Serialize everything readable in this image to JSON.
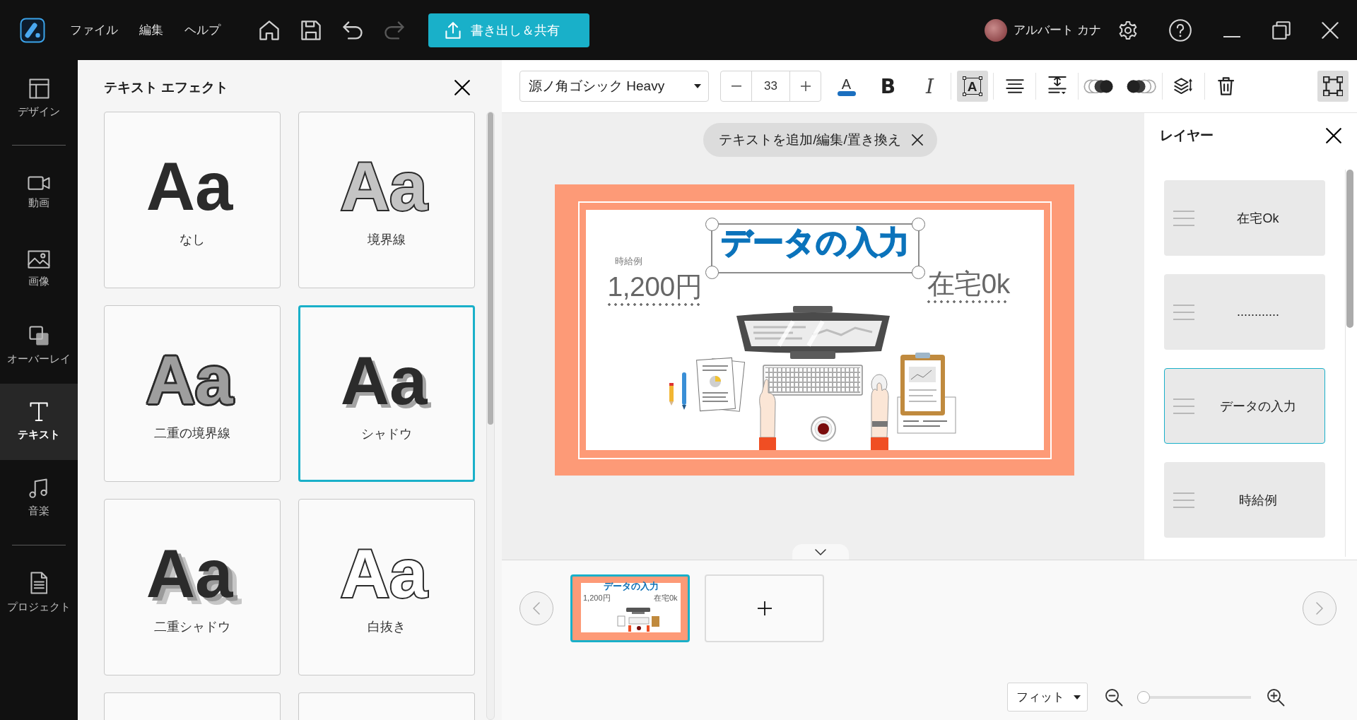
{
  "title_bar": {
    "menu": [
      {
        "label": "ファイル"
      },
      {
        "label": "編集"
      },
      {
        "label": "ヘルプ"
      }
    ],
    "quick_tools": [
      {
        "kind": "home",
        "disabled": false
      },
      {
        "kind": "save",
        "disabled": false
      },
      {
        "kind": "undo",
        "disabled": false
      },
      {
        "kind": "redo",
        "disabled": true
      }
    ],
    "export_button": "書き出し＆共有",
    "user_name": "アルバート カナ",
    "window_buttons": [
      {
        "kind": "settings"
      },
      {
        "kind": "help"
      },
      {
        "kind": "minimize"
      },
      {
        "kind": "restore"
      },
      {
        "kind": "close"
      }
    ]
  },
  "sidebar": {
    "groups": [
      [
        {
          "kind": "design",
          "label": "デザイン",
          "selected": false
        }
      ],
      [
        {
          "kind": "video",
          "label": "動画",
          "selected": false
        },
        {
          "kind": "image",
          "label": "画像",
          "selected": false
        },
        {
          "kind": "overlay",
          "label": "オーバーレイ",
          "selected": false
        },
        {
          "kind": "text",
          "label": "テキスト",
          "selected": true
        },
        {
          "kind": "music",
          "label": "音楽",
          "selected": false
        }
      ],
      [
        {
          "kind": "project",
          "label": "プロジェクト",
          "selected": false
        }
      ]
    ]
  },
  "effects_panel": {
    "title": "テキスト エフェクト",
    "effects": [
      {
        "kind": "none",
        "sample": "Aa",
        "label": "なし",
        "selected": false
      },
      {
        "kind": "outline",
        "sample": "Aa",
        "label": "境界線",
        "selected": false
      },
      {
        "kind": "double_outline",
        "sample": "Aa",
        "label": "二重の境界線",
        "selected": false
      },
      {
        "kind": "shadow",
        "sample": "Aa",
        "label": "シャドウ",
        "selected": true
      },
      {
        "kind": "double_shadow",
        "sample": "Aa",
        "label": "二重シャドウ",
        "selected": false
      },
      {
        "kind": "hollow",
        "sample": "Aa",
        "label": "白抜き",
        "selected": false
      },
      {
        "selected": false
      },
      {
        "selected": false
      }
    ]
  },
  "toolbar": {
    "font_family": "源ノ角ゴシック Heavy",
    "font_size": "33",
    "groups": [
      [
        {
          "kind": "text_color",
          "glyph": "A",
          "selected": false
        },
        {
          "kind": "bold",
          "glyph": "B",
          "selected": false
        },
        {
          "kind": "italic",
          "glyph": "I",
          "selected": false
        }
      ],
      [
        {
          "kind": "text_frame",
          "glyph": "A",
          "selected": true
        }
      ],
      [
        {
          "kind": "align",
          "selected": false
        }
      ],
      [
        {
          "kind": "line_spacing",
          "selected": false
        }
      ],
      [
        {
          "kind": "blend_back",
          "selected": false
        },
        {
          "kind": "blend_front",
          "selected": false
        }
      ],
      [
        {
          "kind": "arrange",
          "selected": false
        }
      ],
      [
        {
          "kind": "delete",
          "selected": false
        }
      ]
    ],
    "end_tool": {
      "kind": "transform",
      "selected": true
    }
  },
  "canvas": {
    "hint": "テキストを追加/編集/置き換え",
    "texts": [
      {
        "kind": "caption",
        "text": "時給例",
        "selected": false
      },
      {
        "kind": "figure",
        "text": "1,200円",
        "selected": false
      },
      {
        "kind": "title",
        "text": "データの入力",
        "selected": true
      },
      {
        "kind": "figure",
        "text": "在宅0k",
        "selected": false
      }
    ]
  },
  "layers_panel": {
    "title": "レイヤー",
    "layers": [
      {
        "name": "在宅Ok",
        "selected": false
      },
      {
        "name": "............",
        "selected": false
      },
      {
        "name": "データの入力",
        "selected": true
      },
      {
        "name": "時給例",
        "selected": false
      }
    ]
  },
  "slides": {
    "items": [
      {
        "selected": true,
        "texts": [
          {
            "kind": "title",
            "text": "データの入力"
          },
          {
            "kind": "figure",
            "text": "1,200円"
          },
          {
            "kind": "figure",
            "text": "在宅0k"
          }
        ]
      }
    ]
  },
  "zoom": {
    "mode": "フィット",
    "level": 0
  }
}
